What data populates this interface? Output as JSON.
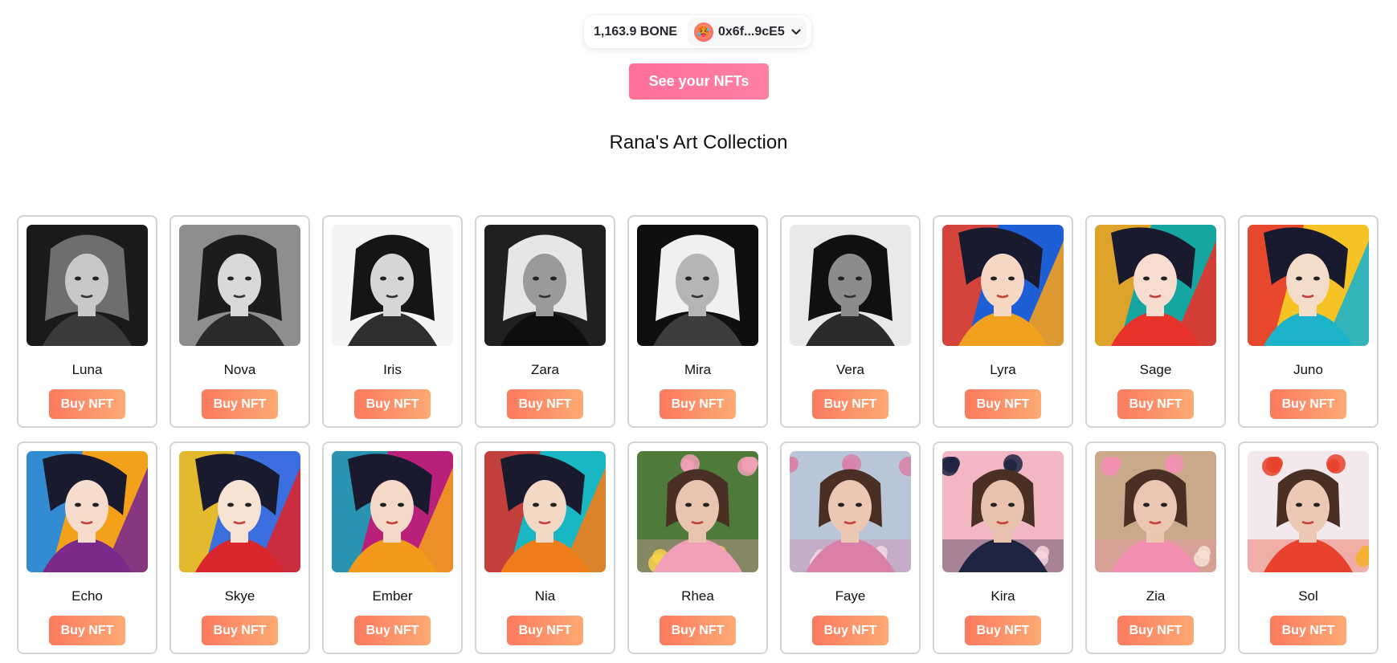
{
  "wallet": {
    "balance": "1,163.9 BONE",
    "address": "0x6f...9cE5",
    "avatar_emoji": "🥵",
    "chevron_icon": "chevron-down-icon"
  },
  "see_nfts_label": "See your NFTs",
  "collection_title": "Rana's Art Collection",
  "buy_label": "Buy NFT",
  "colors": {
    "accent_pink": "#ff6f9a",
    "buy_gradient_start": "#fb7a5f",
    "buy_gradient_end": "#fdaa74",
    "card_border": "#d4d4d4"
  },
  "nfts": [
    {
      "name": "Luna",
      "style": "mono",
      "palette": [
        "#1a1a1a",
        "#6e6e6e",
        "#c8c8c8",
        "#3a3a3a"
      ]
    },
    {
      "name": "Nova",
      "style": "mono",
      "palette": [
        "#8e8e8e",
        "#1c1c1c",
        "#d9d9d9",
        "#2a2a2a"
      ]
    },
    {
      "name": "Iris",
      "style": "mono",
      "palette": [
        "#f4f4f4",
        "#151515",
        "#d6d6d6",
        "#2e2e2e"
      ]
    },
    {
      "name": "Zara",
      "style": "mono",
      "palette": [
        "#202020",
        "#e6e6e6",
        "#9a9a9a",
        "#0e0e0e"
      ]
    },
    {
      "name": "Mira",
      "style": "mono",
      "palette": [
        "#0f0f0f",
        "#f0f0f0",
        "#b5b5b5",
        "#3d3d3d"
      ]
    },
    {
      "name": "Vera",
      "style": "mono",
      "palette": [
        "#e9e9e9",
        "#101010",
        "#8c8c8c",
        "#2b2b2b"
      ]
    },
    {
      "name": "Lyra",
      "style": "vivid",
      "palette": [
        "#1f5fd6",
        "#f2a020",
        "#e8412c",
        "#f6d7c4"
      ]
    },
    {
      "name": "Sage",
      "style": "vivid",
      "palette": [
        "#16a6a2",
        "#e8332a",
        "#f4a31d",
        "#f7dcd0"
      ]
    },
    {
      "name": "Juno",
      "style": "vivid",
      "palette": [
        "#f6c324",
        "#1db3c9",
        "#e63a2e",
        "#f4dccb"
      ]
    },
    {
      "name": "Echo",
      "style": "vivid",
      "palette": [
        "#f3a11b",
        "#7b2a8c",
        "#1e88e5",
        "#f5dccc"
      ]
    },
    {
      "name": "Skye",
      "style": "vivid",
      "palette": [
        "#3b6fe0",
        "#d9262c",
        "#f6c11b",
        "#f7e3d3"
      ]
    },
    {
      "name": "Ember",
      "style": "vivid",
      "palette": [
        "#b8207a",
        "#f39a1d",
        "#19a0b8",
        "#f4d9c8"
      ]
    },
    {
      "name": "Nia",
      "style": "vivid",
      "palette": [
        "#19b7c4",
        "#f07d1b",
        "#d6322c",
        "#f3d8c6"
      ]
    },
    {
      "name": "Rhea",
      "style": "floral",
      "palette": [
        "#4e7a3a",
        "#f2a0b8",
        "#f7d34a",
        "#e9c5b0"
      ]
    },
    {
      "name": "Faye",
      "style": "floral",
      "palette": [
        "#b9c6d8",
        "#d97fa8",
        "#f3d7e3",
        "#ecc7b2"
      ]
    },
    {
      "name": "Kira",
      "style": "floral",
      "palette": [
        "#f2b6c4",
        "#1d2540",
        "#f7d6de",
        "#e8c2ad"
      ]
    },
    {
      "name": "Zia",
      "style": "floral",
      "palette": [
        "#c9a98a",
        "#f28fb0",
        "#f4e2d2",
        "#ebc6b1"
      ]
    },
    {
      "name": "Sol",
      "style": "floral",
      "palette": [
        "#f3e8ec",
        "#e8412c",
        "#f6b12a",
        "#ecc9b4"
      ]
    }
  ]
}
